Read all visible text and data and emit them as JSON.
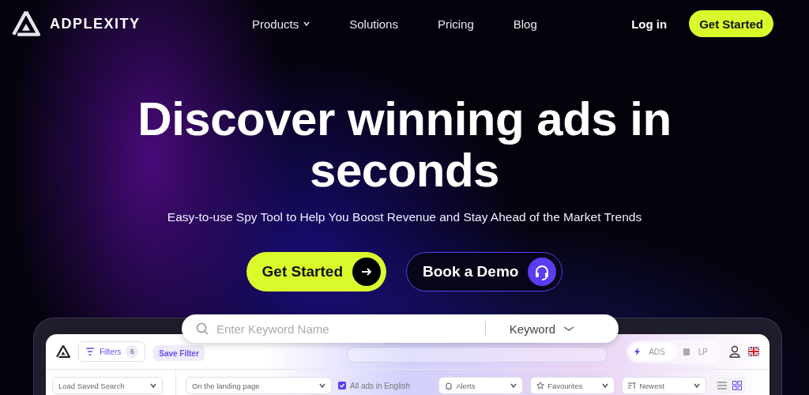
{
  "brand": {
    "name": "ADPLEXITY"
  },
  "nav": {
    "links": [
      {
        "label": "Products",
        "dropdown": true
      },
      {
        "label": "Solutions",
        "dropdown": false
      },
      {
        "label": "Pricing",
        "dropdown": false
      },
      {
        "label": "Blog",
        "dropdown": false
      }
    ],
    "login": "Log in",
    "cta": "Get Started"
  },
  "hero": {
    "headline_lines": [
      "Discover winning ads in",
      "seconds"
    ],
    "subtitle": "Easy-to-use Spy Tool to Help You Boost Revenue and Stay Ahead of the Market Trends",
    "primary_button": "Get Started",
    "secondary_button": "Book a Demo"
  },
  "search": {
    "placeholder": "Enter Keyword Name",
    "type": "Keyword"
  },
  "app": {
    "filters_button": "Filters",
    "filters_count": "6",
    "save_filter": "Save Filter",
    "mode_toggle": [
      {
        "label": "ADS",
        "selected": true
      },
      {
        "label": "LP",
        "selected": false
      }
    ],
    "saved_search": {
      "placeholder": "Load Saved Search"
    },
    "search_scope": "On the landing page",
    "english_only": {
      "label": "All ads in English",
      "checked": true
    },
    "dropdowns": [
      {
        "label": "Alerts",
        "kind": "alerts"
      },
      {
        "label": "Favourites",
        "kind": "favourites"
      },
      {
        "label": "Newest",
        "kind": "sort"
      }
    ],
    "views": [
      {
        "kind": "list",
        "selected": false
      },
      {
        "kind": "grid",
        "selected": true
      }
    ]
  }
}
